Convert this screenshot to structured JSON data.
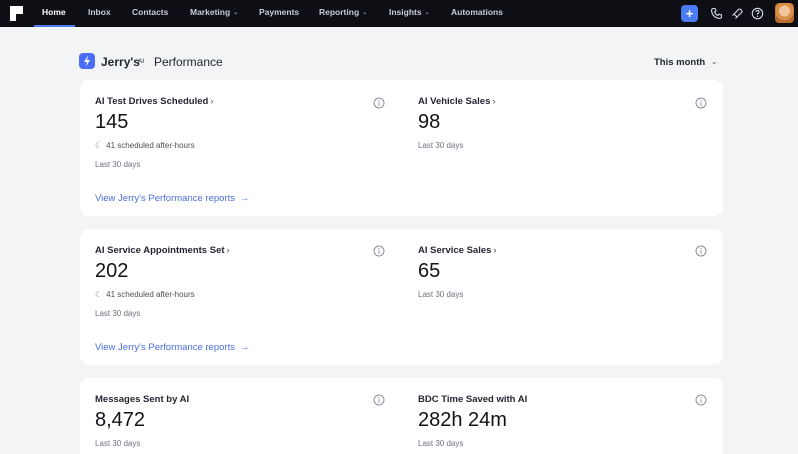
{
  "nav": {
    "items": [
      {
        "label": "Home",
        "caret": false
      },
      {
        "label": "Inbox",
        "caret": false
      },
      {
        "label": "Contacts",
        "caret": false
      },
      {
        "label": "Marketing",
        "caret": true
      },
      {
        "label": "Payments",
        "caret": false
      },
      {
        "label": "Reporting",
        "caret": true
      },
      {
        "label": "Insights",
        "caret": true
      },
      {
        "label": "Automations",
        "caret": false
      }
    ],
    "plus_label": "+"
  },
  "header": {
    "brand": "Jerry's",
    "brand_tag": "AI",
    "title": "Performance",
    "period_selector": "This month"
  },
  "cards": [
    {
      "left": {
        "title": "AI Test Drives Scheduled",
        "value": "145",
        "after_hours": "41 scheduled after-hours",
        "period": "Last 30 days"
      },
      "right": {
        "title": "AI Vehicle Sales",
        "value": "98",
        "period": "Last 30 days"
      },
      "link": "View Jerry's Performance reports"
    },
    {
      "left": {
        "title": "AI Service Appointments Set",
        "value": "202",
        "after_hours": "41 scheduled after-hours",
        "period": "Last 30 days"
      },
      "right": {
        "title": "AI Service Sales",
        "value": "65",
        "period": "Last 30 days"
      },
      "link": "View Jerry's Performance reports"
    },
    {
      "left": {
        "title": "Messages Sent by AI",
        "value": "8,472",
        "period": "Last 30 days"
      },
      "right": {
        "title": "BDC Time Saved with AI",
        "value": "282h 24m",
        "period": "Last 30 days"
      }
    }
  ],
  "glyphs": {
    "chevron": "›",
    "arrow": "→",
    "caret": "⌄",
    "moon": "☾"
  },
  "colors": {
    "accent": "#4a7cf7",
    "link": "#4a6ee0",
    "topbar": "#0d0f14"
  }
}
